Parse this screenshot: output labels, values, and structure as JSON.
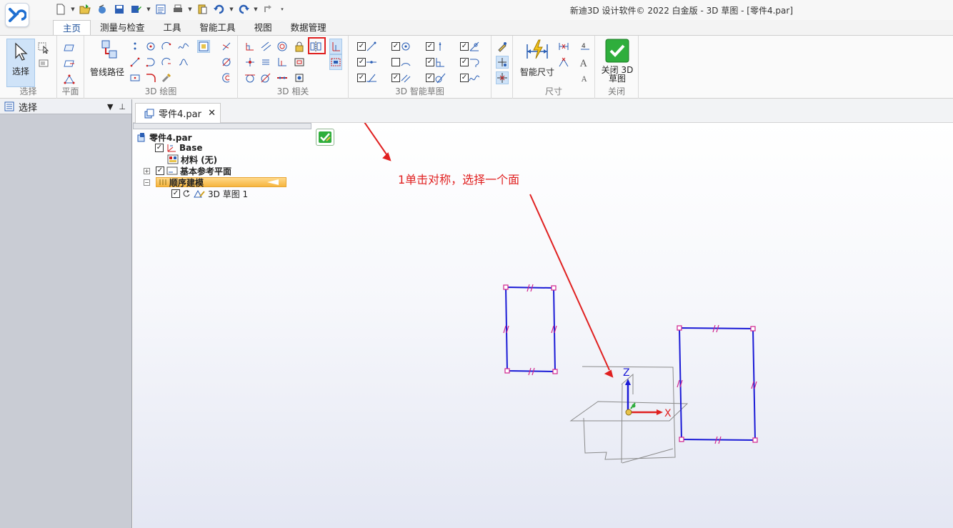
{
  "window": {
    "title": "新迪3D 设计软件© 2022 白金版 - 3D 草图 - [零件4.par]"
  },
  "app_logo": {
    "icon": "xd-logo-icon",
    "color": "#1f6fd1"
  },
  "menu_tabs": [
    {
      "label": "主页",
      "active": true
    },
    {
      "label": "测量与检查"
    },
    {
      "label": "工具"
    },
    {
      "label": "智能工具"
    },
    {
      "label": "视图"
    },
    {
      "label": "数据管理"
    }
  ],
  "ribbon": {
    "groups": {
      "select": "选择",
      "plane": "平面",
      "draw3d": "3D 绘图",
      "relate3d": "3D 相关",
      "smart_sketch": "3D 智能草图",
      "dimension": "尺寸",
      "close": "关闭"
    },
    "buttons": {
      "select": "选择",
      "pipe_path": "管线路径",
      "smart_dimension": "智能尺寸",
      "close_sketch": "关闭 3D 草图"
    }
  },
  "left_panel": {
    "title": "选择"
  },
  "doc_tab": {
    "label": "零件4.par"
  },
  "tree": {
    "root": "零件4.par",
    "base": "Base",
    "material": "材料 (无)",
    "ref_planes": "基本参考平面",
    "sequential": "顺序建模",
    "sketch": "3D 草图 1"
  },
  "annotation": {
    "text": "1单击对称，选择一个面",
    "color": "#e02020"
  },
  "axes": {
    "z": "Z",
    "x": "X"
  },
  "colors": {
    "sketch_line": "#1a1ad6",
    "handle": "#d0208c",
    "accent": "#1a4e9a"
  }
}
